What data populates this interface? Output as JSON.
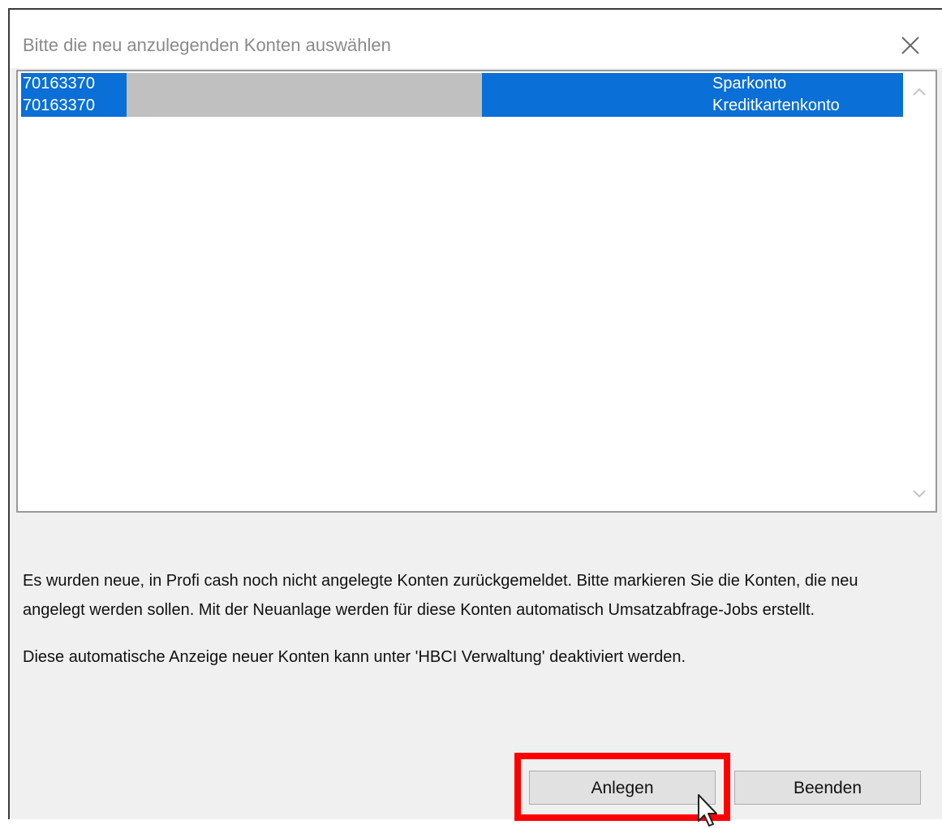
{
  "window": {
    "title": "Bitte die neu anzulegenden Konten auswählen",
    "close_icon": "close-icon"
  },
  "accounts": [
    {
      "number": "70163370",
      "type": "Sparkonto"
    },
    {
      "number": "70163370",
      "type": "Kreditkartenkonto"
    }
  ],
  "message": {
    "paragraph1": "Es wurden neue, in Profi cash noch nicht angelegte Konten zurückgemeldet. Bitte markieren Sie die Konten, die neu angelegt werden sollen. Mit der Neuanlage werden für diese Konten automatisch Umsatzabfrage-Jobs erstellt.",
    "paragraph2": "Diese automatische Anzeige neuer Konten kann unter 'HBCI Verwaltung' deaktiviert werden."
  },
  "buttons": {
    "create_label": "Anlegen",
    "close_label": "Beenden"
  },
  "colors": {
    "selection": "#0a6fd6",
    "highlight": "#ff0000",
    "redaction": "#c0c0c0"
  }
}
